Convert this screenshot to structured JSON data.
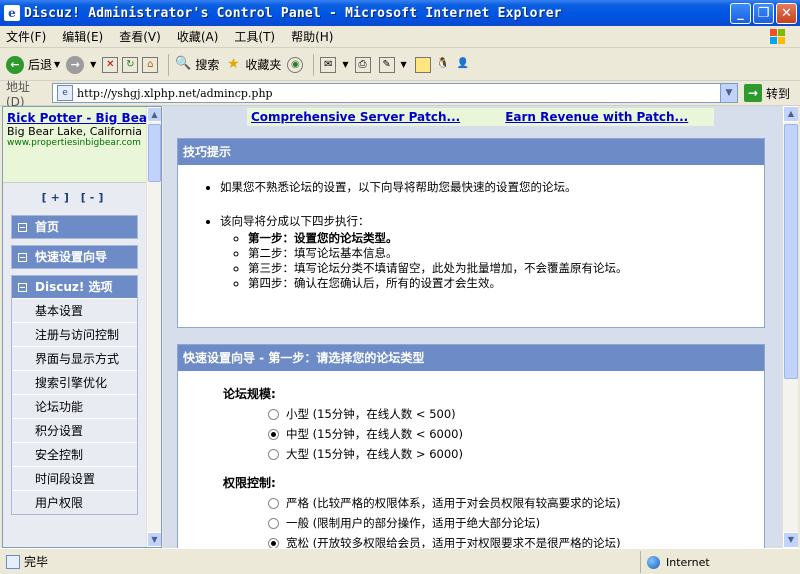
{
  "window": {
    "title": "Discuz! Administrator's Control Panel - Microsoft Internet Explorer",
    "buttons": {
      "minimize": "_",
      "maximize": "❐",
      "close": "✕"
    }
  },
  "menubar": {
    "items": [
      "文件(F)",
      "编辑(E)",
      "查看(V)",
      "收藏(A)",
      "工具(T)",
      "帮助(H)"
    ]
  },
  "toolbar": {
    "back_label": "后退",
    "search_label": "搜索",
    "favorites_label": "收藏夹"
  },
  "addressbar": {
    "label": "地址(D)",
    "url": "http://yshgj.xlphp.net/admincp.php",
    "go_label": "转到"
  },
  "sidebar": {
    "ad": {
      "title": "Rick Potter - Big Bear",
      "desc": "Big Bear Lake, California",
      "url": "www.propertiesinbigbear.com"
    },
    "expand_collapse": "[+]  [-]",
    "sections": [
      {
        "label": "首页"
      },
      {
        "label": "快速设置向导"
      },
      {
        "label": "Discuz! 选项",
        "items": [
          "基本设置",
          "注册与访问控制",
          "界面与显示方式",
          "搜索引擎优化",
          "论坛功能",
          "积分设置",
          "安全控制",
          "时间段设置",
          "用户权限"
        ]
      }
    ]
  },
  "main": {
    "patch_links": [
      "Comprehensive Server Patch...",
      "Earn Revenue with Patch..."
    ],
    "tips": {
      "header": "技巧提示",
      "bullet1": "如果您不熟悉论坛的设置，以下向导将帮助您最快速的设置您的论坛。",
      "bullet2": "该向导将分成以下四步执行：",
      "steps": [
        "第一步：设置您的论坛类型。",
        "第二步：填写论坛基本信息。",
        "第三步：填写论坛分类不填请留空，此处为批量增加，不会覆盖原有论坛。",
        "第四步：确认在您确认后，所有的设置才会生效。"
      ]
    },
    "wizard": {
      "header": "快速设置向导 - 第一步：请选择您的论坛类型",
      "scale_label": "论坛规模:",
      "scale_options": [
        "小型 (15分钟，在线人数 < 500)",
        "中型 (15分钟，在线人数 < 6000)",
        "大型 (15分钟，在线人数 > 6000)"
      ],
      "scale_selected": 1,
      "perm_label": "权限控制:",
      "perm_options": [
        "严格 (比较严格的权限体系，适用于对会员权限有较高要求的论坛)",
        "一般 (限制用户的部分操作，适用于绝大部分论坛)",
        "宽松 (开放较多权限给会员，适用于对权限要求不是很严格的论坛)"
      ],
      "perm_selected": 2
    }
  },
  "statusbar": {
    "text": "完毕",
    "zone": "Internet"
  }
}
